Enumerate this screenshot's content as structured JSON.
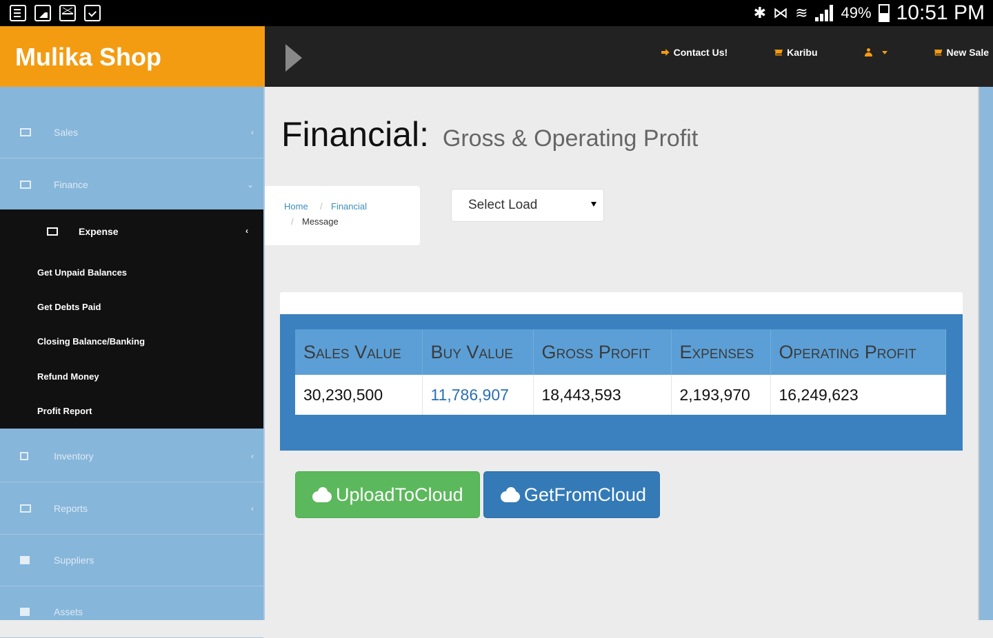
{
  "status_bar": {
    "battery": "49%",
    "time": "10:51 PM"
  },
  "brand": {
    "title": "Mulika Shop"
  },
  "top_nav": {
    "items": [
      {
        "label": "Contact Us!",
        "icon": "sign-in-icon"
      },
      {
        "label": "Karibu",
        "icon": "cart-icon"
      },
      {
        "label": "",
        "icon": "user-icon"
      },
      {
        "label": "New Sale",
        "icon": "cart-icon"
      }
    ]
  },
  "sidebar": {
    "items": [
      {
        "label": "Sales",
        "chevron": "‹"
      },
      {
        "label": "Finance",
        "chevron": "⌄"
      },
      {
        "label": "Inventory",
        "chevron": "‹"
      },
      {
        "label": "Reports",
        "chevron": "‹"
      },
      {
        "label": "Suppliers",
        "chevron": ""
      },
      {
        "label": "Assets",
        "chevron": ""
      }
    ],
    "submenu": {
      "head": "Expense",
      "chevron": "‹",
      "links": [
        "Get Unpaid Balances",
        "Get Debts Paid",
        "Closing Balance/Banking",
        "Refund Money",
        "Profit Report"
      ]
    }
  },
  "page": {
    "title": "Financial:",
    "subtitle": "Gross & Operating Profit"
  },
  "breadcrumb": {
    "home": "Home",
    "sep": "/",
    "financial": "Financial",
    "message": "Message"
  },
  "load_select": {
    "value": "Select Load"
  },
  "financial_table": {
    "headers": [
      "Sales Value",
      "Buy Value",
      "Gross Profit",
      "Expenses",
      "Operating Profit"
    ],
    "row": [
      "30,230,500",
      "11,786,907",
      "18,443,593",
      "2,193,970",
      "16,249,623"
    ]
  },
  "buttons": {
    "upload": "UploadToCloud",
    "get": "GetFromCloud"
  }
}
